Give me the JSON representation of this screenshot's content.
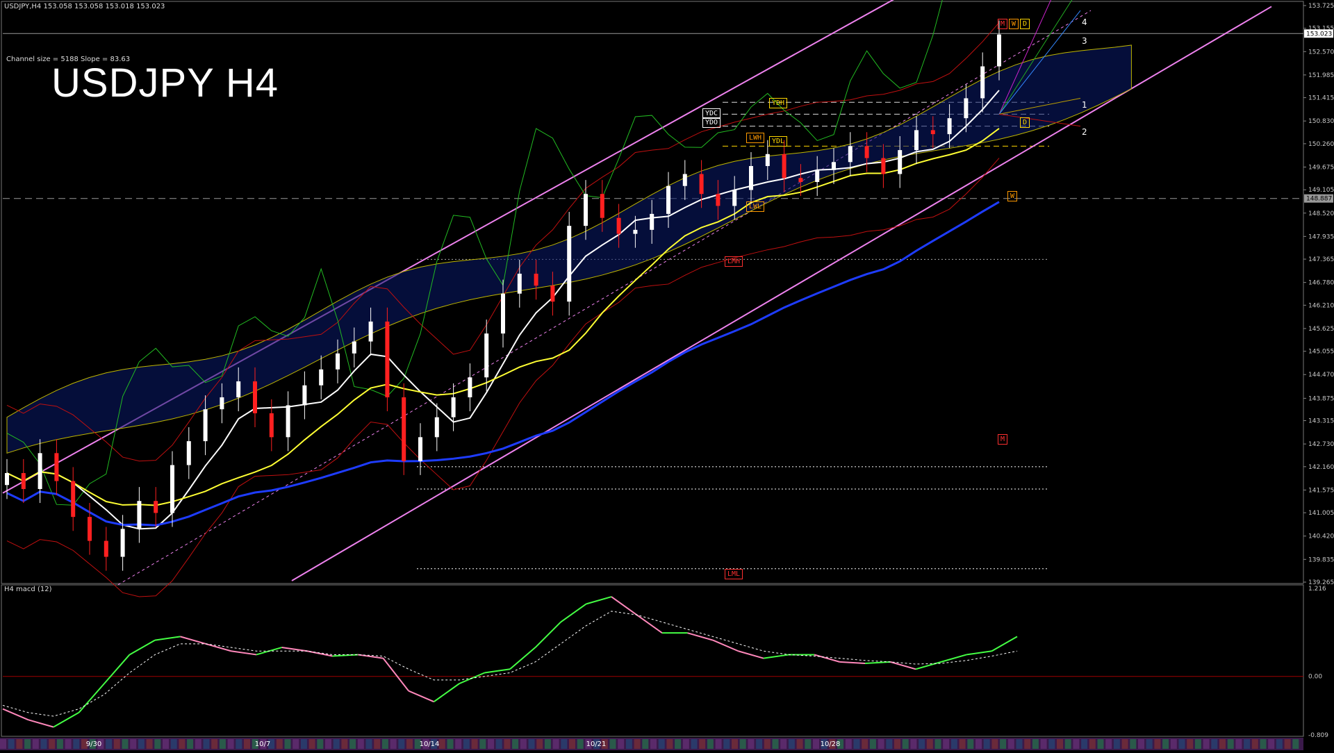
{
  "window": {
    "symbol_header": "USDJPY,H4  153.058 153.058 153.018 153.023",
    "channel_info": "Channel size = 5188 Slope = 83.63",
    "big_title": "USDJPY H4",
    "macd_title": "H4  macd (12)"
  },
  "colors": {
    "background": "#000000",
    "bull_candle": "#ffffff",
    "bear_candle": "#ff2020",
    "channel": "#ee82ee",
    "ma_white": "#ffffff",
    "ma_yellow": "#ffff33",
    "ma_blue": "#1e3cff",
    "bands": "#c01010",
    "chikou": "#22bb22",
    "macd_up": "#44ff44",
    "macd_down": "#ff88bb",
    "signal": "#ffffff",
    "axis_text": "#c8c8c8"
  },
  "annotations": {
    "ydc": "YDC",
    "ydo": "YDO",
    "ydh": "YDH",
    "ydl": "YDL",
    "lwh": "LWH",
    "lwl": "LWL",
    "lmh": "LMH",
    "lml": "LML",
    "m_mark": "M",
    "w_mark": "W",
    "d_mark": "D",
    "fan_labels": [
      "4",
      "3",
      "1",
      "2"
    ],
    "current_price_tag": "153.023",
    "dash_price_tag": "148.887"
  },
  "chart_data": [
    {
      "type": "line",
      "title": "USDJPY H4",
      "ylim": [
        139.265,
        153.725
      ],
      "y_ticks": [
        "153.725",
        "153.155",
        "152.570",
        "151.985",
        "151.415",
        "150.830",
        "150.260",
        "149.675",
        "149.105",
        "148.520",
        "147.935",
        "147.365",
        "146.780",
        "146.210",
        "145.625",
        "145.055",
        "144.470",
        "143.875",
        "143.315",
        "142.730",
        "142.160",
        "141.575",
        "141.005",
        "140.420",
        "139.835",
        "139.265"
      ],
      "x_labels": [
        "9/30",
        "10/7",
        "10/14",
        "10/21",
        "10/28"
      ],
      "current_price": 153.023,
      "series": [
        {
          "name": "close",
          "values": [
            142.0,
            141.6,
            142.5,
            141.8,
            140.9,
            140.3,
            139.9,
            140.6,
            141.3,
            141.0,
            142.2,
            142.8,
            143.6,
            143.9,
            144.3,
            143.5,
            142.9,
            143.7,
            144.2,
            144.6,
            145.0,
            145.3,
            145.8,
            143.9,
            142.3,
            142.9,
            143.4,
            143.9,
            144.4,
            145.5,
            146.5,
            147.0,
            146.7,
            146.3,
            148.2,
            149.0,
            148.4,
            148.0,
            148.1,
            148.5,
            149.2,
            149.5,
            149.0,
            148.7,
            149.1,
            149.7,
            150.0,
            149.4,
            149.3,
            149.6,
            149.8,
            150.2,
            149.9,
            149.5,
            150.1,
            150.6,
            150.5,
            150.9,
            151.4,
            152.2,
            153.0
          ]
        },
        {
          "name": "",
          "values": []
        }
      ]
    },
    {
      "type": "line",
      "title": "H4  macd (12)",
      "ylim": [
        -0.809,
        1.216
      ],
      "y_ticks": [
        "1.216",
        "0.00",
        "-0.809"
      ],
      "series": [
        {
          "name": "macd",
          "values": [
            -0.45,
            -0.6,
            -0.7,
            -0.5,
            -0.1,
            0.3,
            0.5,
            0.55,
            0.45,
            0.35,
            0.3,
            0.4,
            0.35,
            0.28,
            0.3,
            0.25,
            -0.2,
            -0.35,
            -0.1,
            0.05,
            0.1,
            0.4,
            0.75,
            1.0,
            1.1,
            0.85,
            0.6,
            0.6,
            0.5,
            0.35,
            0.25,
            0.3,
            0.3,
            0.2,
            0.18,
            0.2,
            0.1,
            0.2,
            0.3,
            0.35,
            0.55
          ]
        },
        {
          "name": "signal",
          "values": [
            -0.4,
            -0.5,
            -0.55,
            -0.45,
            -0.25,
            0.05,
            0.3,
            0.45,
            0.45,
            0.4,
            0.35,
            0.35,
            0.35,
            0.3,
            0.3,
            0.28,
            0.1,
            -0.05,
            -0.05,
            0.0,
            0.05,
            0.2,
            0.45,
            0.7,
            0.9,
            0.85,
            0.75,
            0.65,
            0.55,
            0.45,
            0.35,
            0.3,
            0.28,
            0.25,
            0.22,
            0.2,
            0.17,
            0.18,
            0.22,
            0.28,
            0.35
          ]
        }
      ]
    }
  ]
}
